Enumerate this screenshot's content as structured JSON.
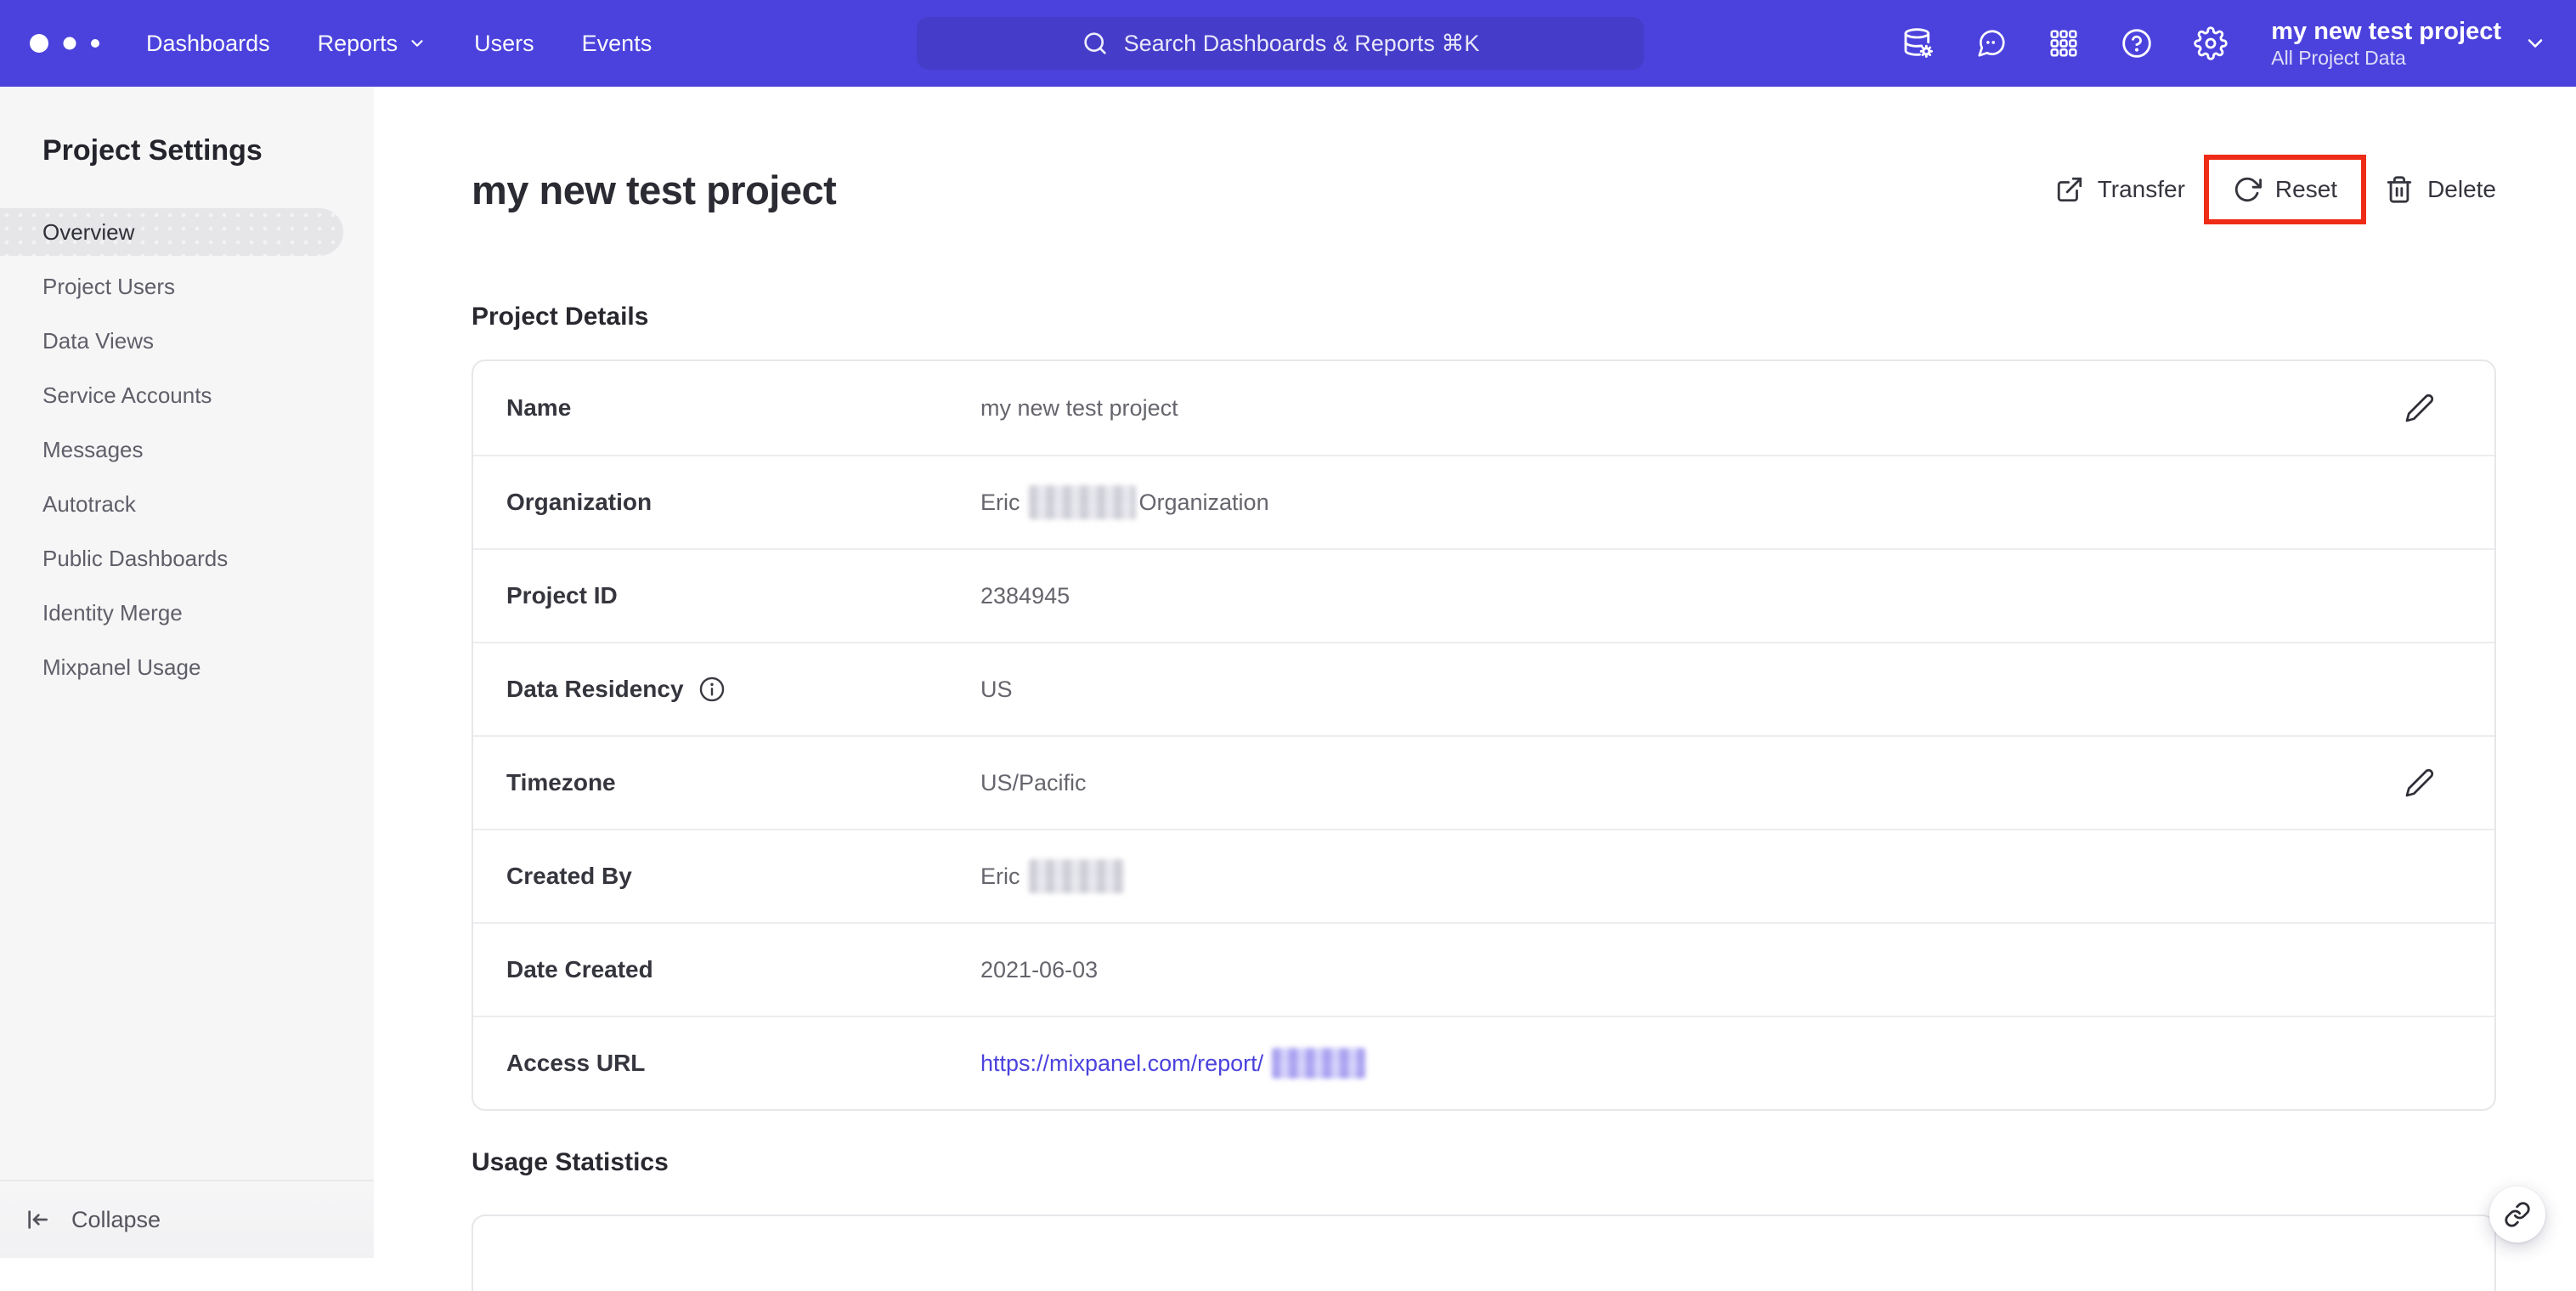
{
  "colors": {
    "brand_purple": "#4b42dd",
    "annotation_red": "#ee2b16",
    "link_purple": "#4b42dd"
  },
  "navbar": {
    "items": [
      {
        "label": "Dashboards"
      },
      {
        "label": "Reports",
        "has_dropdown": true
      },
      {
        "label": "Users"
      },
      {
        "label": "Events"
      }
    ],
    "search": {
      "placeholder": "Search Dashboards & Reports ⌘K"
    },
    "right_icons": [
      "data-management",
      "messages",
      "app-grid",
      "help",
      "settings-gear"
    ],
    "project_switcher": {
      "name": "my new test project",
      "scope": "All Project Data"
    }
  },
  "sidebar": {
    "title": "Project Settings",
    "items": [
      {
        "label": "Overview",
        "selected": true
      },
      {
        "label": "Project Users"
      },
      {
        "label": "Data Views"
      },
      {
        "label": "Service Accounts"
      },
      {
        "label": "Messages"
      },
      {
        "label": "Autotrack"
      },
      {
        "label": "Public Dashboards"
      },
      {
        "label": "Identity Merge"
      },
      {
        "label": "Mixpanel Usage"
      }
    ],
    "collapse_label": "Collapse"
  },
  "main": {
    "title": "my new test project",
    "actions": [
      {
        "label": "Transfer",
        "icon": "transfer-icon"
      },
      {
        "label": "Reset",
        "icon": "reset-icon",
        "highlighted": true
      },
      {
        "label": "Delete",
        "icon": "delete-icon"
      }
    ],
    "sections": [
      {
        "title": "Project Details",
        "rows": [
          {
            "label": "Name",
            "value": "my new test project",
            "editable": true
          },
          {
            "label": "Organization",
            "value_prefix": "Eric",
            "redacted": true,
            "value_suffix": "Organization"
          },
          {
            "label": "Project ID",
            "value": "2384945"
          },
          {
            "label": "Data Residency",
            "has_info_icon": true,
            "value": "US"
          },
          {
            "label": "Timezone",
            "value": "US/Pacific",
            "editable": true
          },
          {
            "label": "Created By",
            "value_prefix": "Eric",
            "redacted": true
          },
          {
            "label": "Date Created",
            "value": "2021-06-03"
          },
          {
            "label": "Access URL",
            "link_prefix": "https://mixpanel.com/report/",
            "redacted": true
          }
        ]
      },
      {
        "title": "Usage Statistics"
      }
    ]
  }
}
